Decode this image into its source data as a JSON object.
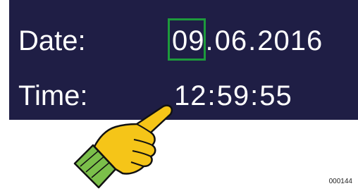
{
  "date": {
    "label": "Date:",
    "day": "09",
    "separator": ".",
    "month": "06",
    "year": "2016"
  },
  "time": {
    "label": "Time:",
    "hours": "12",
    "separator": ":",
    "minutes": "59",
    "seconds": "55"
  },
  "highlight": {
    "field": "day",
    "color": "#1d9a3c"
  },
  "colors": {
    "screen_background": "#1f1e45",
    "text": "#ffffff",
    "hand_fill": "#f5c518",
    "cuff_fill": "#7bbf4a"
  },
  "pointer": {
    "icon": "pointing-hand-icon",
    "target": "time-value"
  },
  "figure_id": "000144"
}
